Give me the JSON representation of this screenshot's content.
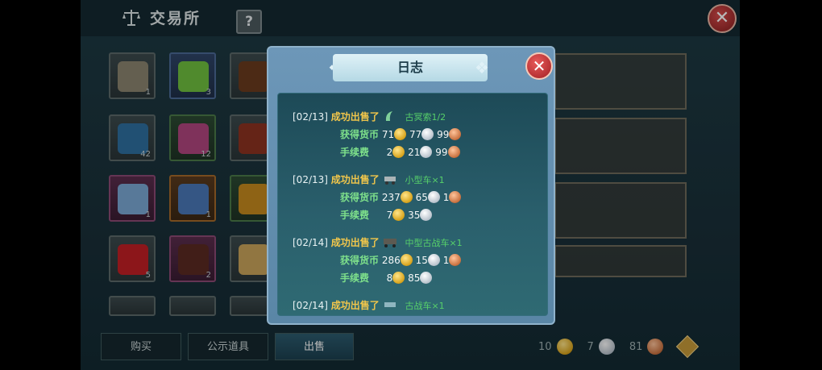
{
  "header": {
    "title": "交易所",
    "help_label": "?",
    "close_label": "✕"
  },
  "inventory": [
    {
      "count": "1",
      "color": "gray",
      "icon": "rope-icon"
    },
    {
      "count": "3",
      "color": "blue",
      "icon": "jar-icon"
    },
    {
      "count": "",
      "color": "gray",
      "icon": "wood-icon"
    },
    {
      "count": "42",
      "color": "gray",
      "icon": "coral-icon"
    },
    {
      "count": "12",
      "color": "green",
      "icon": "crystal-icon"
    },
    {
      "count": "5",
      "color": "gray",
      "icon": "leaf-icon"
    },
    {
      "count": "1",
      "color": "purple",
      "icon": "gem-icon"
    },
    {
      "count": "1",
      "color": "orange",
      "icon": "scarf-icon"
    },
    {
      "count": "",
      "color": "gray",
      "icon": "flower-icon"
    },
    {
      "count": "5",
      "color": "gray",
      "icon": "strawberry-icon"
    },
    {
      "count": "2",
      "color": "gray",
      "icon": "nuts-icon"
    },
    {
      "count": "",
      "color": "gray",
      "icon": "bamboo-icon"
    }
  ],
  "tabs": {
    "buy": "购买",
    "public": "公示道具",
    "sell": "出售"
  },
  "currency": {
    "gold": "10",
    "silver": "7",
    "copper": "81",
    "add_label": "+"
  },
  "dialog": {
    "title": "日志",
    "close_label": "✕",
    "entries": [
      {
        "date": "[02/13]",
        "action": "成功出售了",
        "item_name": "古冥索1/2",
        "earned_label": "获得货币",
        "earned": [
          "71",
          "77",
          "99"
        ],
        "fee_label": "手续费",
        "fee": [
          "2",
          "21",
          "99"
        ]
      },
      {
        "date": "[02/13]",
        "action": "成功出售了",
        "item_name": "小型车×1",
        "earned_label": "获得货币",
        "earned": [
          "237",
          "65",
          "1"
        ],
        "fee_label": "手续费",
        "fee": [
          "7",
          "35"
        ]
      },
      {
        "date": "[02/14]",
        "action": "成功出售了",
        "item_name": "中型古战车×1",
        "earned_label": "获得货币",
        "earned": [
          "286",
          "15",
          "1"
        ],
        "fee_label": "手续费",
        "fee": [
          "8",
          "85"
        ]
      },
      {
        "date": "[02/14]",
        "action": "成功出售了",
        "item_name": "古战车×1"
      }
    ]
  },
  "colors": {
    "accent_gold": "#f1c64b",
    "label_green": "#7ee08b",
    "close_red": "#c8373a"
  }
}
